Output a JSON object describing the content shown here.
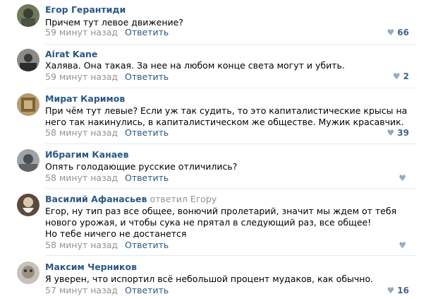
{
  "comments": [
    {
      "author": "Егор Герантиди",
      "reply_to": "",
      "text": "Причем тут левое движение?",
      "time": "59 минут назад",
      "reply_label": "Ответить",
      "likes": "66"
    },
    {
      "author": "Airat Kane",
      "reply_to": "",
      "text": "Халява. Она такая. За нее на любом конце света могут и убить.",
      "time": "59 минут назад",
      "reply_label": "Ответить",
      "likes": "2"
    },
    {
      "author": "Мират Каримов",
      "reply_to": "",
      "text": "При чём тут левые? Если уж так судить, то это капиталистические крысы на него так накинулись, в капиталистическом же обществе. Мужик красавчик.",
      "time": "58 минут назад",
      "reply_label": "Ответить",
      "likes": "39"
    },
    {
      "author": "Ибрагим Канаев",
      "reply_to": "",
      "text": "Опять голодающие русские отличились?",
      "time": "58 минут назад",
      "reply_label": "Ответить",
      "likes": ""
    },
    {
      "author": "Василий Афанасьев",
      "reply_to_prefix": "ответил",
      "reply_to": "Егору",
      "text": "Егор, ну тип раз все общее, вонючий пролетарий, значит мы ждем от тебя нового урожая, и чтобы сука не прятал в следующий раз, все общее!",
      "text2": "Но тебе ничего не достанется",
      "time": "58 минут назад",
      "reply_label": "Ответить",
      "likes": ""
    },
    {
      "author": "Максим Черников",
      "reply_to": "",
      "text": "Я уверен, что испортил всё небольшой процент мудаков, как обычно.",
      "time": "57 минут назад",
      "reply_label": "Ответить",
      "likes": "16"
    }
  ],
  "colors": {
    "author": "#2a5885",
    "meta": "#939393",
    "like_count": "#42648b",
    "heart": "#99aabd",
    "divider": "#e7e8ec"
  },
  "icons": {
    "like": "heart-icon"
  }
}
